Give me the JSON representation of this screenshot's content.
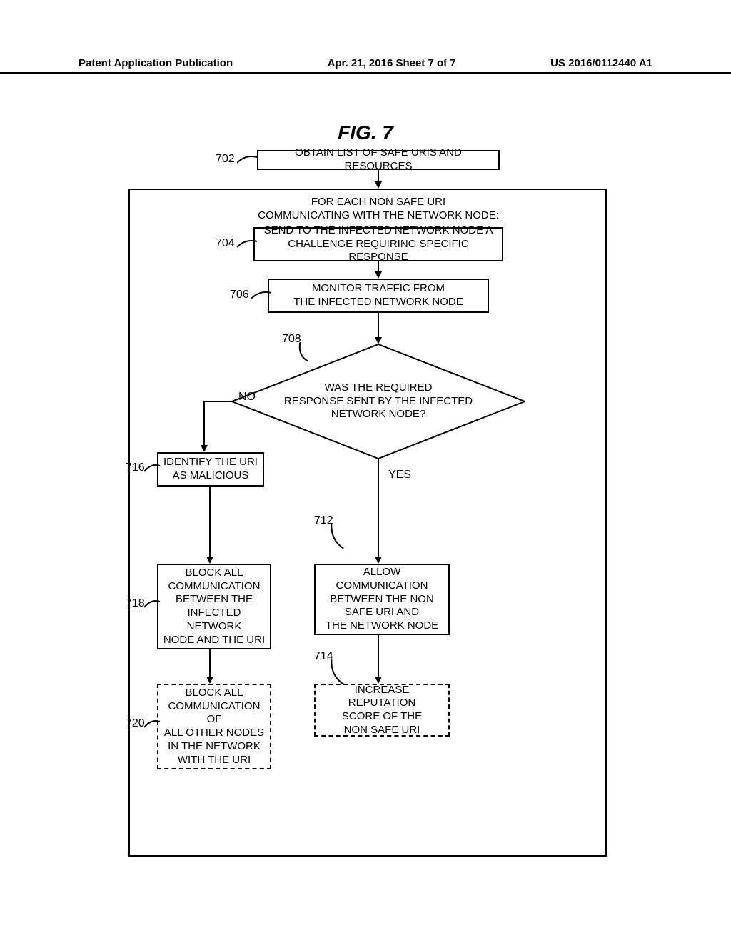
{
  "header": {
    "left": "Patent Application Publication",
    "middle": "Apr. 21, 2016  Sheet 7 of 7",
    "right": "US 2016/0112440 A1"
  },
  "figure_title": "FIG.  7",
  "refs": {
    "r702": "702",
    "r704": "704",
    "r706": "706",
    "r708": "708",
    "r712": "712",
    "r714": "714",
    "r716": "716",
    "r718": "718",
    "r720": "720"
  },
  "labels": {
    "no": "NO",
    "yes": "YES"
  },
  "boxes": {
    "b702": "OBTAIN LIST OF SAFE URIS AND RESOURCES",
    "loop_header": "FOR EACH NON SAFE URI\nCOMMUNICATING WITH THE NETWORK NODE:",
    "b704": "SEND TO THE INFECTED NETWORK NODE A\nCHALLENGE REQUIRING SPECIFIC RESPONSE",
    "b706": "MONITOR TRAFFIC FROM\nTHE INFECTED NETWORK NODE",
    "b708": "WAS THE REQUIRED\nRESPONSE SENT BY THE INFECTED\nNETWORK NODE?",
    "b712": "ALLOW COMMUNICATION\nBETWEEN THE NON\nSAFE URI AND\nTHE NETWORK NODE",
    "b714": "INCREASE REPUTATION\nSCORE OF THE\nNON SAFE URI",
    "b716": "IDENTIFY THE URI\nAS MALICIOUS",
    "b718": "BLOCK ALL\nCOMMUNICATION\nBETWEEN THE\nINFECTED NETWORK\nNODE AND THE URI",
    "b720": "BLOCK ALL\nCOMMUNICATION OF\nALL OTHER NODES\nIN THE NETWORK\nWITH THE URI"
  }
}
